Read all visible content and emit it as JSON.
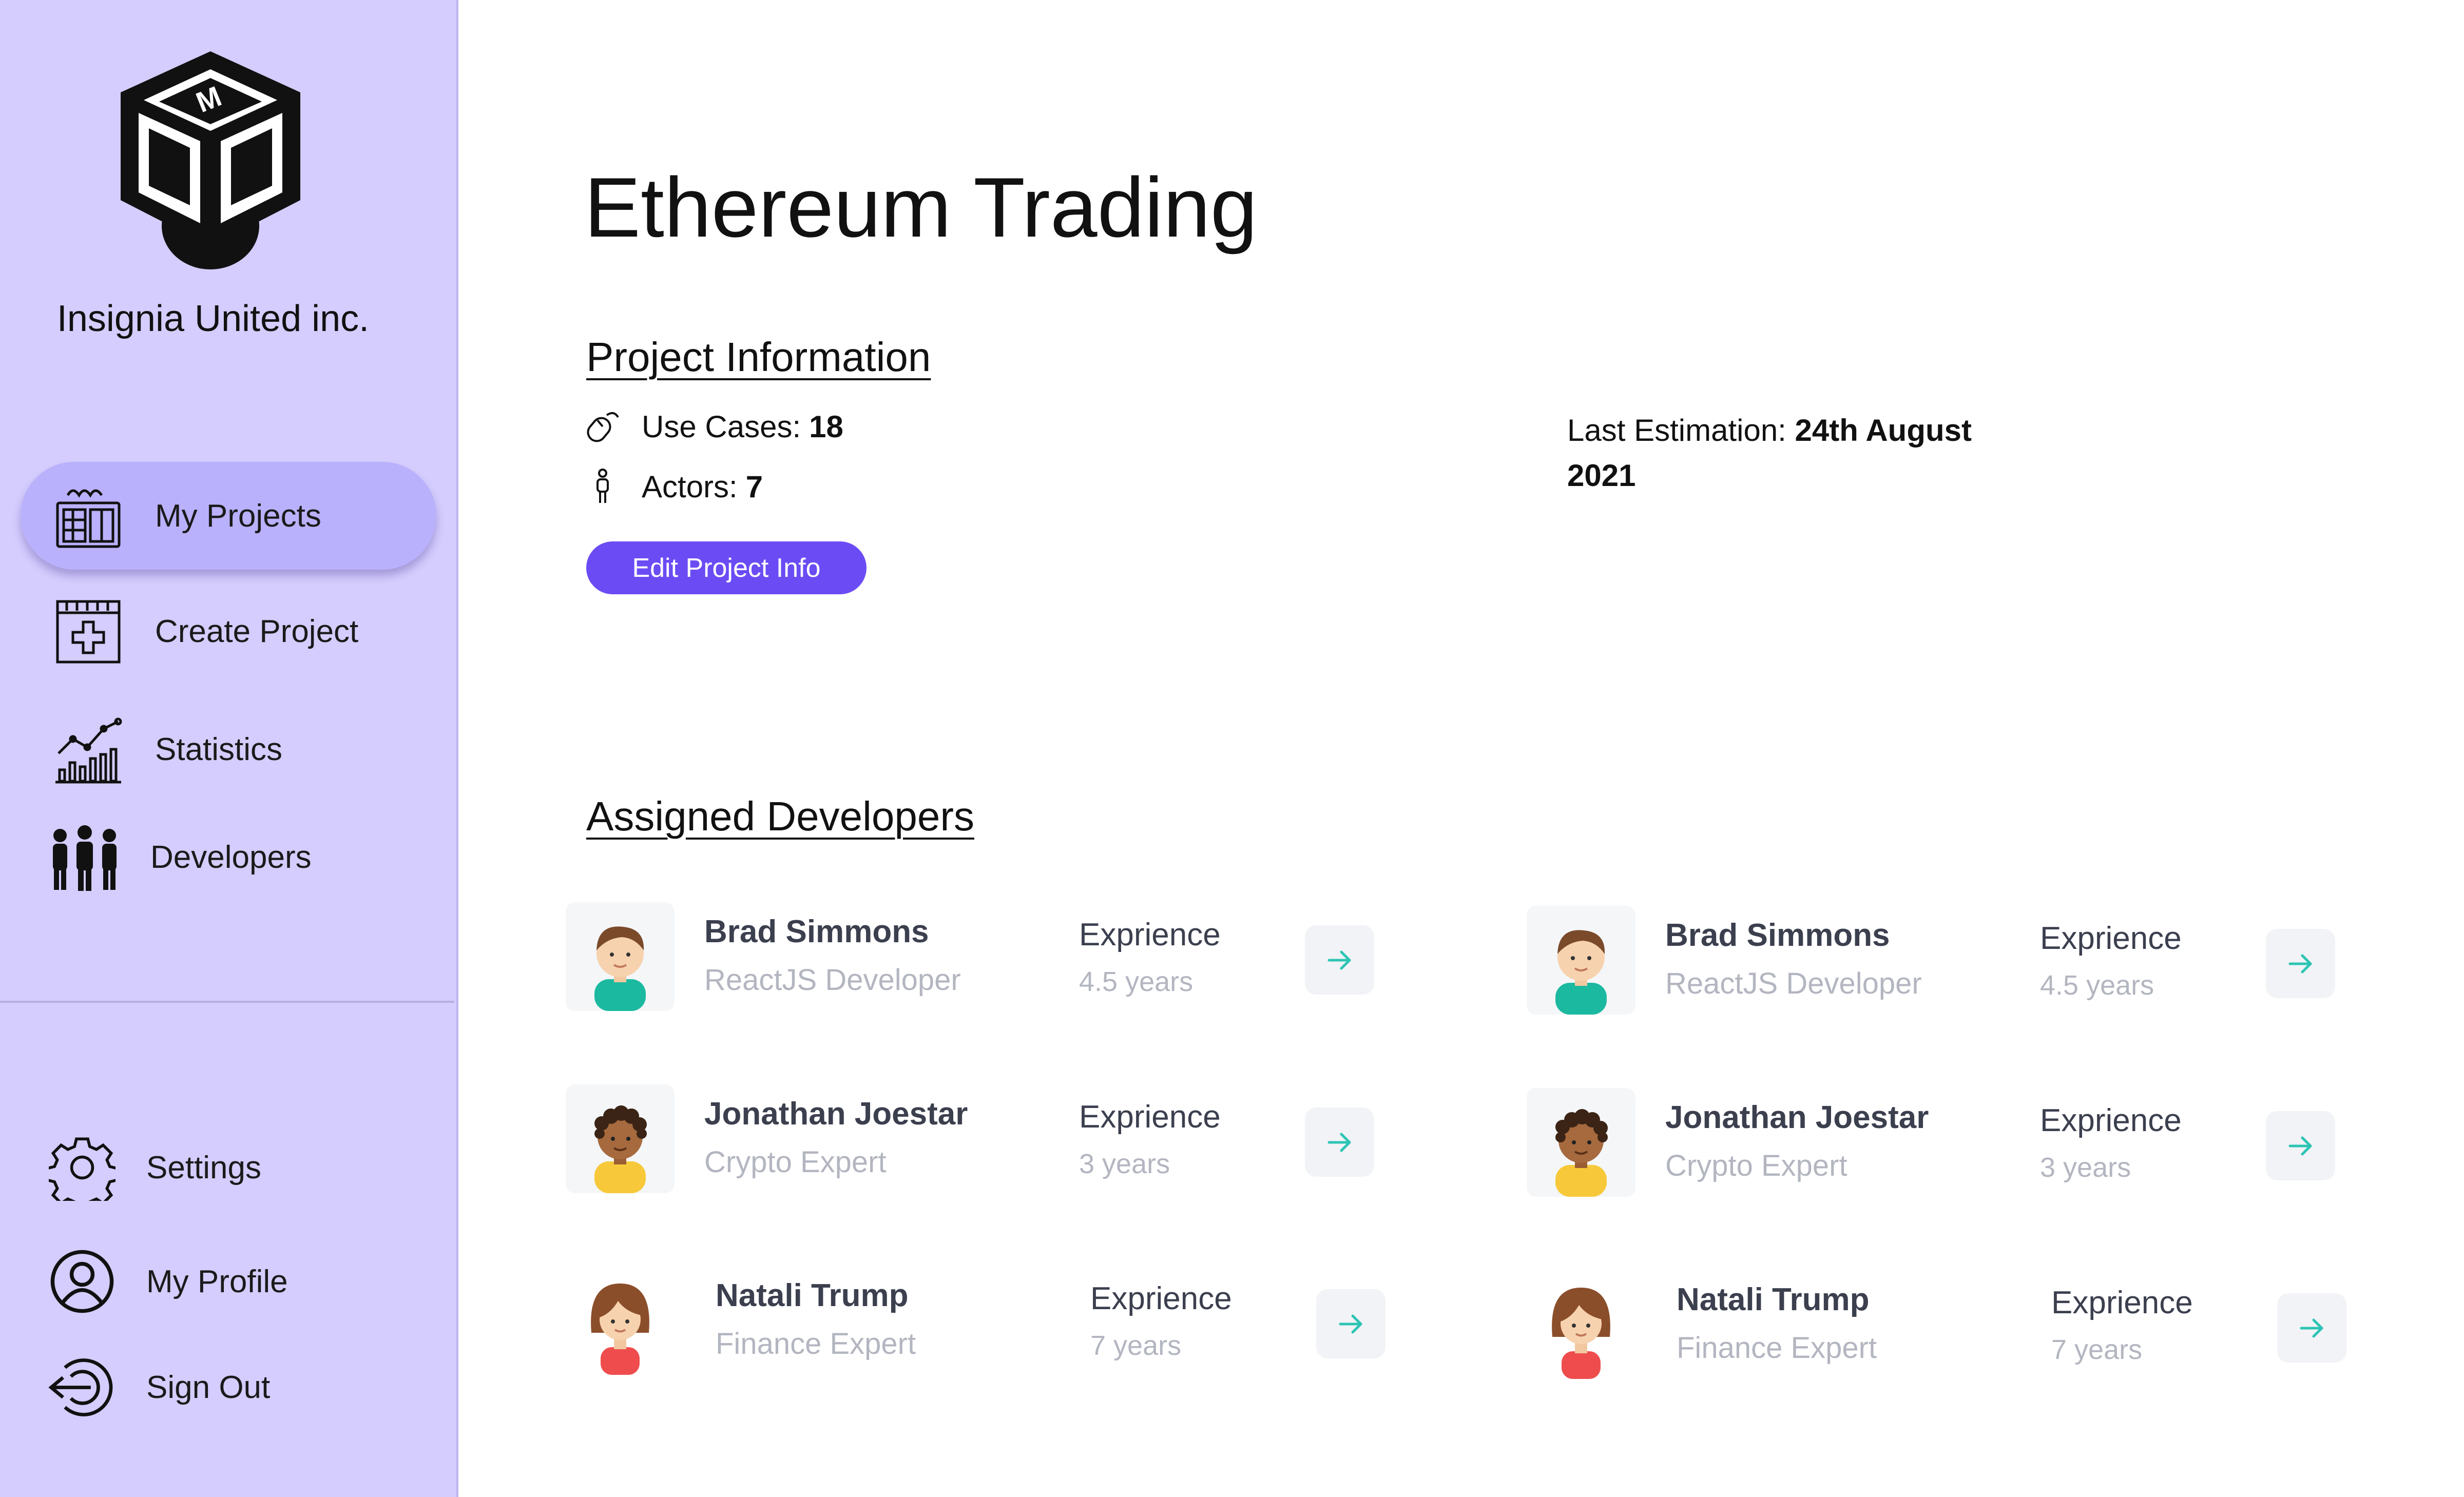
{
  "sidebar": {
    "company": "Insignia United inc.",
    "nav": [
      {
        "label": "My Projects",
        "icon": "building-icon",
        "active": true
      },
      {
        "label": "Create Project",
        "icon": "add-calendar-icon"
      },
      {
        "label": "Statistics",
        "icon": "chart-icon"
      },
      {
        "label": "Developers",
        "icon": "people-icon"
      }
    ],
    "bottom": [
      {
        "label": "Settings",
        "icon": "gear-icon"
      },
      {
        "label": "My Profile",
        "icon": "user-circle-icon"
      },
      {
        "label": "Sign Out",
        "icon": "sign-out-icon"
      }
    ]
  },
  "main": {
    "title": "Ethereum Trading",
    "project_info": {
      "heading": "Project Information",
      "use_cases_label": "Use Cases:",
      "use_cases_value": "18",
      "actors_label": "Actors:",
      "actors_value": "7",
      "estimation_label": "Last Estimation:",
      "estimation_value": "24th August 2021",
      "edit_button": "Edit Project Info"
    },
    "developers": {
      "heading": "Assigned Developers",
      "exp_label": "Exprience",
      "list": [
        {
          "name": "Brad Simmons",
          "role": "ReactJS Developer",
          "experience": "4.5 years",
          "avatar": "male-avatar"
        },
        {
          "name": "Brad Simmons",
          "role": "ReactJS Developer",
          "experience": "4.5 years",
          "avatar": "male-avatar"
        },
        {
          "name": "Jonathan Joestar",
          "role": "Crypto Expert",
          "experience": "3 years",
          "avatar": "curly-avatar"
        },
        {
          "name": "Jonathan Joestar",
          "role": "Crypto Expert",
          "experience": "3 years",
          "avatar": "curly-avatar"
        },
        {
          "name": "Natali Trump",
          "role": "Finance Expert",
          "experience": "7 years",
          "avatar": "female-avatar"
        },
        {
          "name": "Natali Trump",
          "role": "Finance Expert",
          "experience": "7 years",
          "avatar": "female-avatar"
        }
      ]
    }
  },
  "colors": {
    "sidebar_bg": "#d4cdfd",
    "active_nav": "#b9b1fb",
    "primary_button": "#6b4cf4",
    "arrow": "#2cc4b4"
  }
}
